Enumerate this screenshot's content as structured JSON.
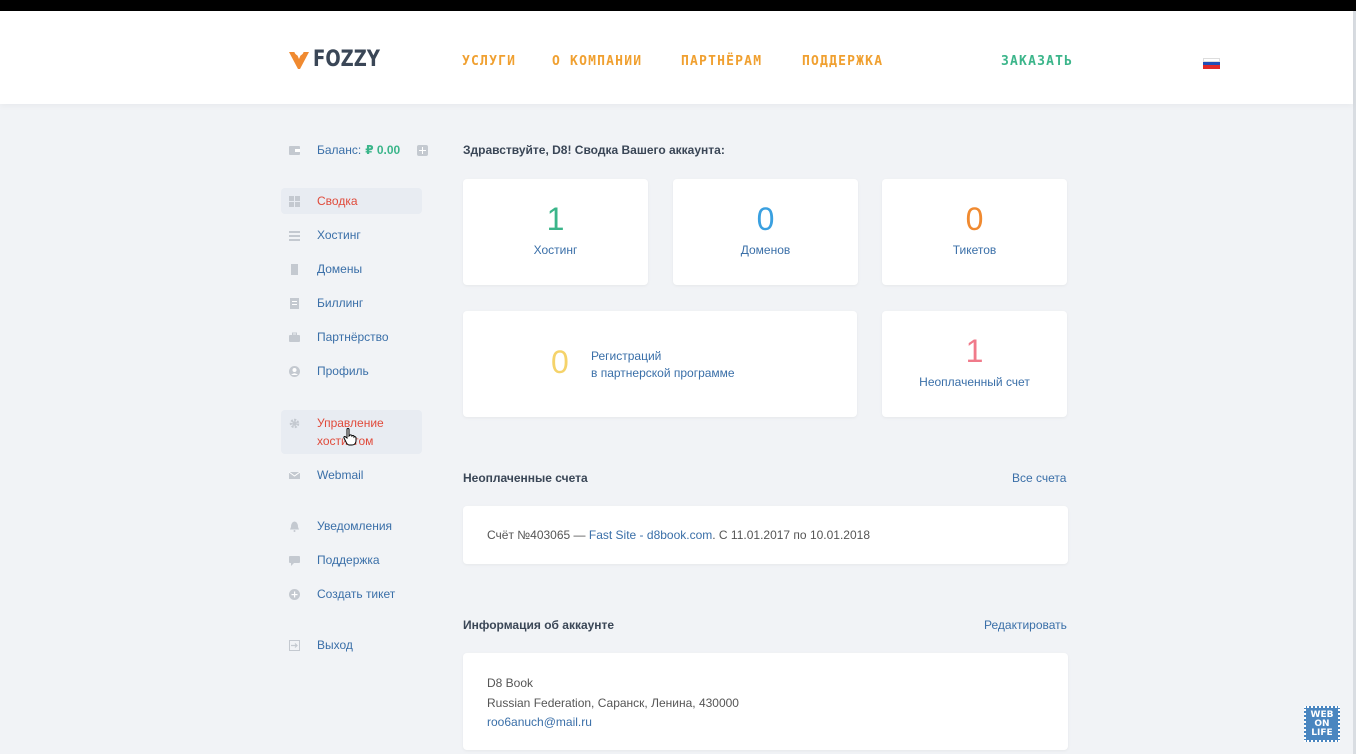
{
  "header": {
    "logo_text": "FOZZY",
    "nav": [
      "УСЛУГИ",
      "О КОМПАНИИ",
      "ПАРТНЁРАМ",
      "ПОДДЕРЖКА"
    ],
    "order": "ЗАКАЗАТЬ",
    "flag_colors": [
      "#ffffff",
      "#1f4fb8",
      "#e02a2a"
    ]
  },
  "sidebar": {
    "balance_label": "Баланс:",
    "balance_amount": "₽ 0.00",
    "items": [
      {
        "label": "Сводка",
        "icon": "dashboard-icon"
      },
      {
        "label": "Хостинг",
        "icon": "list-icon"
      },
      {
        "label": "Домены",
        "icon": "domain-icon"
      },
      {
        "label": "Биллинг",
        "icon": "document-icon"
      },
      {
        "label": "Партнёрство",
        "icon": "briefcase-icon"
      },
      {
        "label": "Профиль",
        "icon": "user-icon"
      },
      {
        "label_line1": "Управление",
        "label_line2": "хостингом",
        "icon": "gear-icon"
      },
      {
        "label": "Webmail",
        "icon": "mail-icon"
      },
      {
        "label": "Уведомления",
        "icon": "bell-icon"
      },
      {
        "label": "Поддержка",
        "icon": "chat-icon"
      },
      {
        "label": "Создать тикет",
        "icon": "plus-circle-icon"
      },
      {
        "label": "Выход",
        "icon": "exit-icon"
      }
    ]
  },
  "main": {
    "greeting": "Здравствуйте, D8! Сводка Вашего аккаунта:",
    "stats": [
      {
        "value": "1",
        "label": "Хостинг",
        "color": "#3bb58a"
      },
      {
        "value": "0",
        "label": "Доменов",
        "color": "#3aa0e0"
      },
      {
        "value": "0",
        "label": "Тикетов",
        "color": "#f08a30"
      }
    ],
    "partner": {
      "value": "0",
      "line1": "Регистраций",
      "line2": "в партнерской программе",
      "color": "#f5d36a"
    },
    "unpaid": {
      "value": "1",
      "label": "Неоплаченный счет",
      "color": "#f07a8a"
    },
    "invoices": {
      "title": "Неоплаченные счета",
      "link": "Все счета",
      "line_prefix": "Счёт №403065 — ",
      "line_link": "Fast Site - d8book.com",
      "line_suffix": ". С 11.01.2017 по 10.01.2018"
    },
    "account": {
      "title": "Информация об аккаунте",
      "link": "Редактировать",
      "name": "D8 Book",
      "address": "Russian Federation, Саранск, Ленина, 430000",
      "email": "roo6anuch@mail.ru"
    }
  },
  "watermark": {
    "l1": "WEB",
    "l2": "ON",
    "l3": "LIFE"
  }
}
